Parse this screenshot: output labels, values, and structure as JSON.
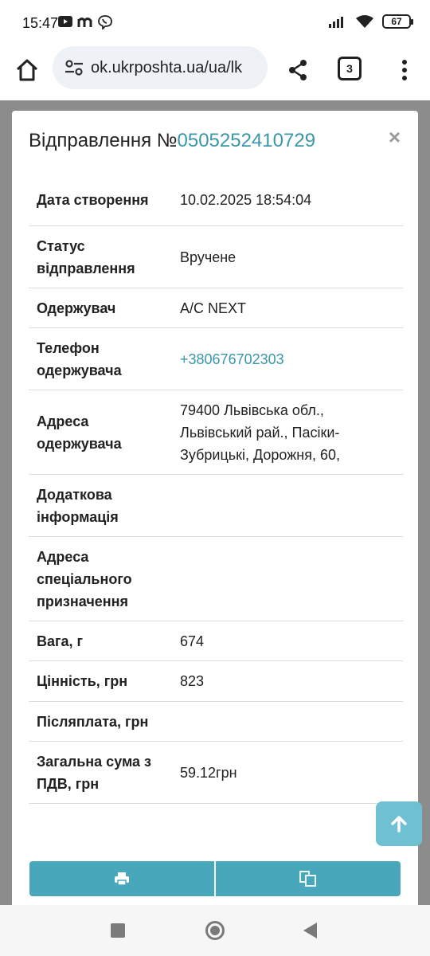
{
  "status_bar": {
    "time": "15:47",
    "battery": "67",
    "icons": [
      "youtube-icon",
      "m-app-icon",
      "viber-icon",
      "signal-icon",
      "wifi-icon",
      "battery-icon"
    ]
  },
  "browser": {
    "url": "ok.ukrposhta.ua/ua/lk",
    "tab_count": "3",
    "icons": [
      "home-icon",
      "site-settings-icon",
      "share-icon",
      "tabs-icon",
      "more-vert-icon"
    ]
  },
  "modal": {
    "title_prefix": "Відправлення №",
    "tracking_number": "0505252410729",
    "close": "×",
    "rows": [
      {
        "label": "Дата створення",
        "value": "10.02.2025 18:54:04"
      },
      {
        "label": "Статус відправлення",
        "value": "Вручене"
      },
      {
        "label": "Одержувач",
        "value": "А/С NEXT"
      },
      {
        "label": "Телефон одержувача",
        "value": "+380676702303"
      },
      {
        "label": "Адреса одержувача",
        "value": "79400 Львівська обл., Львівський рай., Пасіки-Зубрицькі, Дорожня, 60,"
      },
      {
        "label": "Додаткова інформація",
        "value": ""
      },
      {
        "label": "Адреса спеціального призначення",
        "value": ""
      },
      {
        "label": "Вага, г",
        "value": "674"
      },
      {
        "label": "Цінність, грн",
        "value": "823"
      },
      {
        "label": "Післяплата, грн",
        "value": ""
      },
      {
        "label": "Загальна сума з ПДВ, грн",
        "value": "59.12грн"
      }
    ],
    "buttons": {
      "print_icon": "print-icon",
      "copy_icon": "copy-icon"
    }
  },
  "colors": {
    "accent": "#3a97a9",
    "button": "#48a7ba",
    "scroll_button": "#6fc1d2",
    "overlay": "#8c8c8c"
  }
}
